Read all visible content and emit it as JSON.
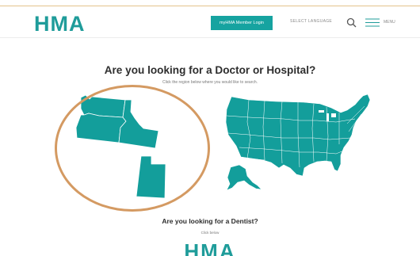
{
  "header": {
    "logo": "HMA",
    "login_label": "myHMA Member Login",
    "language_label": "SELECT LANGUAGE",
    "menu_label": "MENU",
    "icons": {
      "search": "search-icon",
      "menu": "hamburger-menu-icon"
    }
  },
  "main": {
    "heading": "Are you looking for a Doctor or Hospital?",
    "subheading": "Click the region below where you would like to search.",
    "dentist_heading": "Are you looking for a Dentist?",
    "dentist_subheading": "Click below",
    "dentist_logo": "HMA"
  },
  "colors": {
    "brand_teal": "#1f9c9a",
    "button_teal": "#16a3a0",
    "highlight_circle": "#d49a62"
  }
}
